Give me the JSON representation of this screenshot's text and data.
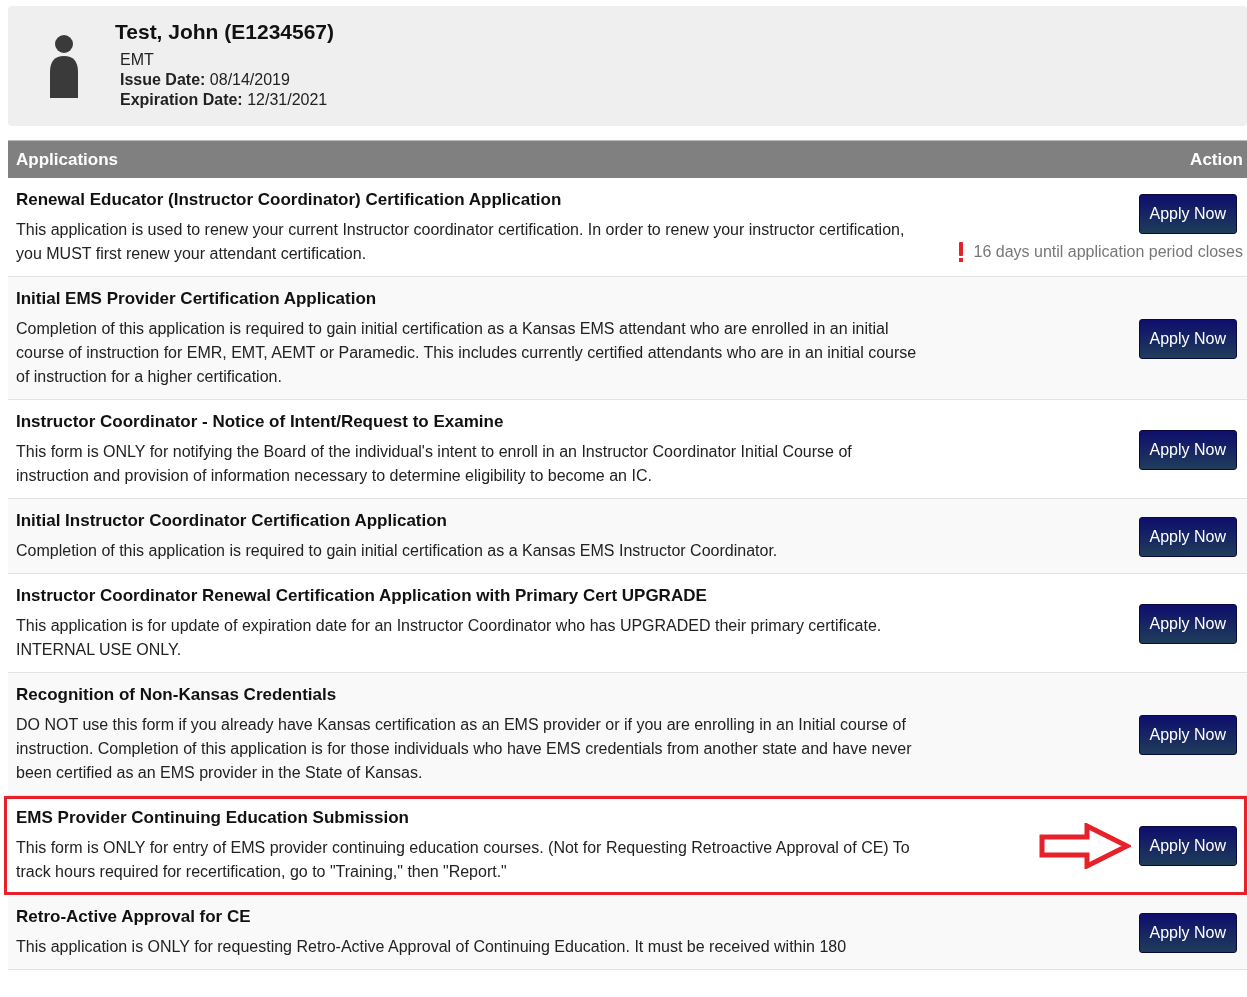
{
  "profile": {
    "name": "Test, John (E1234567)",
    "level": "EMT",
    "issue_label": "Issue Date:",
    "issue_date": "08/14/2019",
    "expiration_label": "Expiration Date:",
    "expiration_date": "12/31/2021"
  },
  "table": {
    "columns": [
      "Applications",
      "Action"
    ],
    "rows": [
      {
        "title": "Renewal Educator (Instructor Coordinator) Certification Application",
        "description": "This application is used to renew your current Instructor coordinator certification. In order to renew your instructor certification, you MUST first renew your attendant certification.",
        "button": "Apply Now",
        "warning": "16 days until application period closes",
        "highlighted": false
      },
      {
        "title": "Initial EMS Provider Certification Application",
        "description": "Completion of this application is required to gain initial certification as a Kansas EMS attendant who are enrolled in an initial course of instruction for EMR, EMT, AEMT or Paramedic. This includes currently certified attendants who are in an initial course of instruction for a higher certification.",
        "button": "Apply Now",
        "highlighted": false
      },
      {
        "title": "Instructor Coordinator - Notice of Intent/Request to Examine",
        "description": "This form is ONLY for notifying the Board of the individual's intent to enroll in an Instructor Coordinator Initial Course of instruction and provision of information necessary to determine eligibility to become an IC.",
        "button": "Apply Now",
        "highlighted": false
      },
      {
        "title": "Initial Instructor Coordinator Certification Application",
        "description": "Completion of this application is required to gain initial certification as a Kansas EMS Instructor Coordinator.",
        "button": "Apply Now",
        "highlighted": false
      },
      {
        "title": "Instructor Coordinator Renewal Certification Application with Primary Cert UPGRADE",
        "description": "This application is for update of expiration date for an Instructor Coordinator who has UPGRADED their primary certificate. INTERNAL USE ONLY.",
        "button": "Apply Now",
        "highlighted": false
      },
      {
        "title": "Recognition of Non-Kansas Credentials",
        "description": "DO NOT use this form if you already have Kansas certification as an EMS provider or if you are enrolling in an Initial course of instruction. Completion of this application is for those individuals who have EMS credentials from another state and have never been certified as an EMS provider in the State of Kansas.",
        "button": "Apply Now",
        "highlighted": false
      },
      {
        "title": "EMS Provider Continuing Education Submission",
        "description": "This form is ONLY for entry of EMS provider continuing education courses. (Not for Requesting Retroactive Approval of CE) To track hours required for recertification, go to \"Training,\" then \"Report.\"",
        "button": "Apply Now",
        "highlighted": true
      },
      {
        "title": "Retro-Active Approval for CE",
        "description": "This application is ONLY for requesting Retro-Active Approval of Continuing Education. It must be received within 180",
        "button": "Apply Now",
        "highlighted": false
      }
    ]
  }
}
